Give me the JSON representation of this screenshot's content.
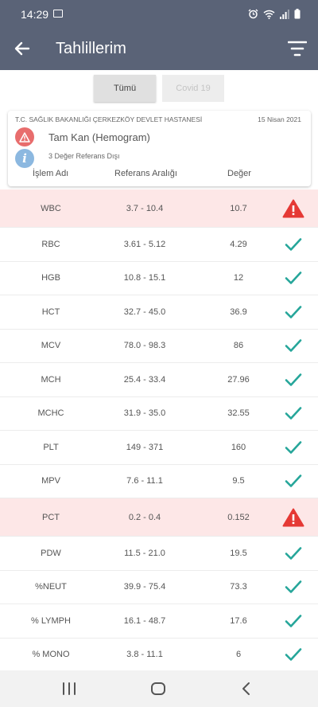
{
  "status_bar": {
    "time": "14:29",
    "icons": [
      "gallery-icon",
      "alarm-icon",
      "wifi-icon",
      "signal-icon",
      "battery-icon"
    ]
  },
  "app_bar": {
    "title": "Tahlillerim",
    "icons": [
      "back-arrow-icon",
      "filter-icon"
    ]
  },
  "tabs": [
    {
      "label": "Tümü",
      "active": true
    },
    {
      "label": "Covid 19",
      "active": false
    }
  ],
  "card": {
    "hospital": "T.C. SAĞLIK BAKANLIĞI ÇERKEZKÖY DEVLET HASTANESİ",
    "date": "15 Nisan 2021",
    "test_name": "Tam Kan (Hemogram)",
    "out_of_range_text": "3 Değer Referans Dışı",
    "headers": {
      "name": "İşlem Adı",
      "range": "Referans Aralığı",
      "value": "Değer"
    }
  },
  "results": [
    {
      "name": "WBC",
      "range": "3.7 - 10.4",
      "value": "10.7",
      "status": "alert"
    },
    {
      "name": "RBC",
      "range": "3.61 - 5.12",
      "value": "4.29",
      "status": "ok"
    },
    {
      "name": "HGB",
      "range": "10.8 - 15.1",
      "value": "12",
      "status": "ok"
    },
    {
      "name": "HCT",
      "range": "32.7 - 45.0",
      "value": "36.9",
      "status": "ok"
    },
    {
      "name": "MCV",
      "range": "78.0 - 98.3",
      "value": "86",
      "status": "ok"
    },
    {
      "name": "MCH",
      "range": "25.4 - 33.4",
      "value": "27.96",
      "status": "ok"
    },
    {
      "name": "MCHC",
      "range": "31.9 - 35.0",
      "value": "32.55",
      "status": "ok"
    },
    {
      "name": "PLT",
      "range": "149 - 371",
      "value": "160",
      "status": "ok"
    },
    {
      "name": "MPV",
      "range": "7.6 - 11.1",
      "value": "9.5",
      "status": "ok"
    },
    {
      "name": "PCT",
      "range": "0.2 - 0.4",
      "value": "0.152",
      "status": "alert"
    },
    {
      "name": "PDW",
      "range": "11.5 - 21.0",
      "value": "19.5",
      "status": "ok"
    },
    {
      "name": "%NEUT",
      "range": "39.9 - 75.4",
      "value": "73.3",
      "status": "ok"
    },
    {
      "name": "% LYMPH",
      "range": "16.1 - 48.7",
      "value": "17.6",
      "status": "ok"
    },
    {
      "name": "% MONO",
      "range": "3.8 - 11.1",
      "value": "6",
      "status": "ok"
    }
  ],
  "colors": {
    "header_bg": "#5a6377",
    "alert_row_bg": "#fde7e7",
    "alert_icon": "#e53935",
    "check_icon": "#26a69a"
  },
  "nav_bar": {
    "icons": [
      "recent-apps-icon",
      "home-icon",
      "back-icon"
    ]
  }
}
